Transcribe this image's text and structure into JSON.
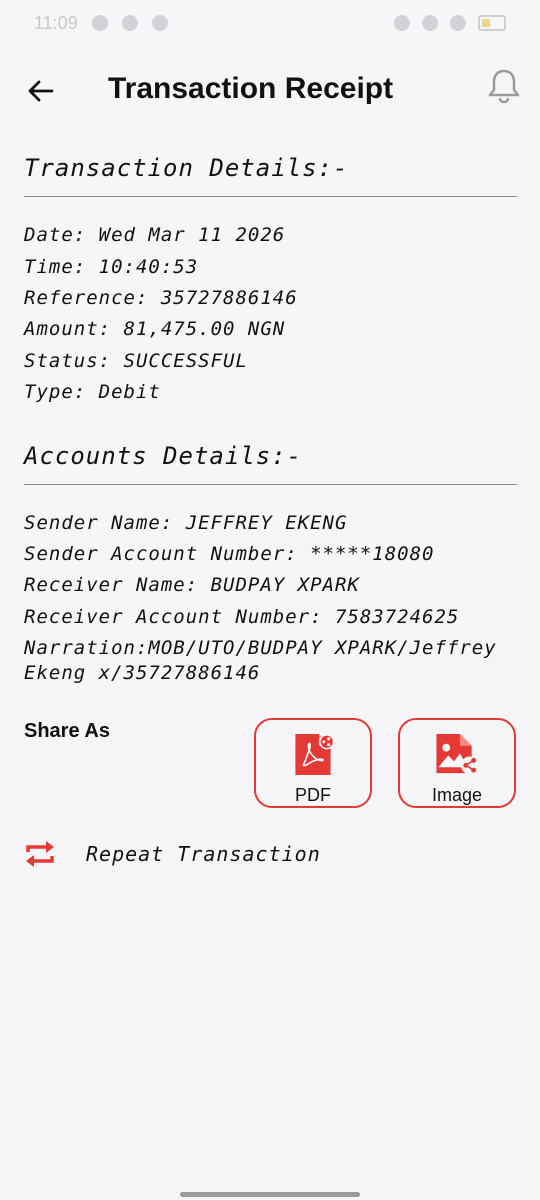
{
  "status_bar": {
    "time": "11:09"
  },
  "header": {
    "title": "Transaction Receipt"
  },
  "transaction_section": {
    "title": "Transaction Details:-",
    "date": "Date: Wed Mar 11 2026",
    "time": "Time: 10:40:53",
    "reference": "Reference: 35727886146",
    "amount": "Amount: 81,475.00 NGN",
    "status": "Status: SUCCESSFUL",
    "type": "Type: Debit"
  },
  "accounts_section": {
    "title": "Accounts Details:-",
    "sender_name": "Sender Name: JEFFREY EKENG",
    "sender_account": "Sender Account Number: *****18080",
    "receiver_name": "Receiver Name: BUDPAY XPARK",
    "receiver_account": "Receiver Account Number: 7583724625",
    "narration_line1": "Narration:MOB/UTO/BUDPAY XPARK/Jeffrey",
    "narration_line2": "Ekeng x/35727886146"
  },
  "share": {
    "label": "Share As",
    "pdf_label": "PDF",
    "image_label": "Image"
  },
  "repeat": {
    "label": "Repeat Transaction"
  },
  "colors": {
    "accent": "#e53935",
    "background": "#f6f6f8"
  }
}
